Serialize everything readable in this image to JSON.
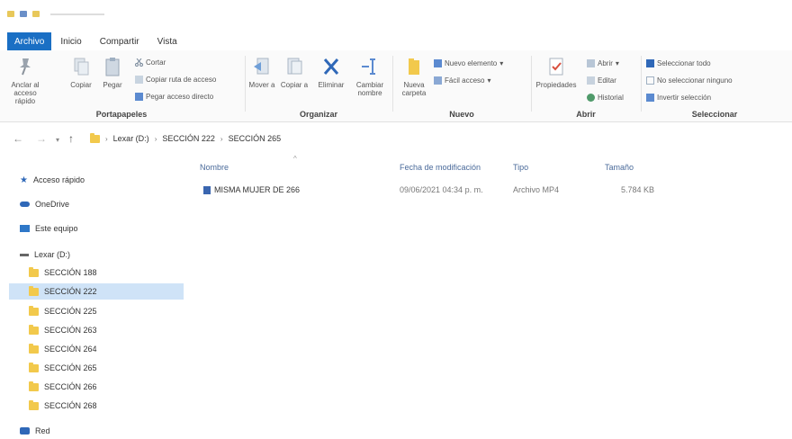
{
  "ribbon_tabs": [
    "Archivo",
    "Inicio",
    "Compartir",
    "Vista"
  ],
  "ribbon": {
    "portapapeles": {
      "label": "Portapapeles",
      "anclar": "Anclar al acceso rápido",
      "copiar": "Copiar",
      "pegar": "Pegar",
      "cortar": "Cortar",
      "copiar_ruta": "Copiar ruta de acceso",
      "pegar_acceso": "Pegar acceso directo"
    },
    "organizar": {
      "label": "Organizar",
      "mover": "Mover a",
      "copiar_a": "Copiar a",
      "eliminar": "Eliminar",
      "cambiar_nombre": "Cambiar nombre"
    },
    "nuevo": {
      "label": "Nuevo",
      "nueva_carpeta": "Nueva carpeta",
      "nuevo_elemento": "Nuevo elemento",
      "facil_acceso": "Fácil acceso"
    },
    "abrir": {
      "label": "Abrir",
      "propiedades": "Propiedades",
      "abrir": "Abrir",
      "editar": "Editar",
      "historial": "Historial"
    },
    "seleccionar": {
      "label": "Seleccionar",
      "todo": "Seleccionar todo",
      "ninguno": "No seleccionar ninguno",
      "invertir": "Invertir selección"
    }
  },
  "address": {
    "crumbs": [
      "Lexar (D:)",
      "SECCIÓN 222",
      "SECCIÓN 265"
    ]
  },
  "navpane": {
    "acceso_rapido": "Acceso rápido",
    "onedrive": "OneDrive",
    "este_equipo": "Este equipo",
    "lexar": "Lexar (D:)",
    "folders": [
      "SECCIÓN 188",
      "SECCIÓN 222",
      "SECCIÓN 225",
      "SECCIÓN 263",
      "SECCIÓN 264",
      "SECCIÓN 265",
      "SECCIÓN 266",
      "SECCIÓN 268"
    ],
    "red": "Red"
  },
  "columns": {
    "nombre": "Nombre",
    "fecha": "Fecha de modificación",
    "tipo": "Tipo",
    "tamano": "Tamaño"
  },
  "files": [
    {
      "name": "MISMA MUJER DE 266",
      "date": "09/06/2021 04:34 p. m.",
      "type": "Archivo MP4",
      "size": "5.784 KB"
    }
  ]
}
